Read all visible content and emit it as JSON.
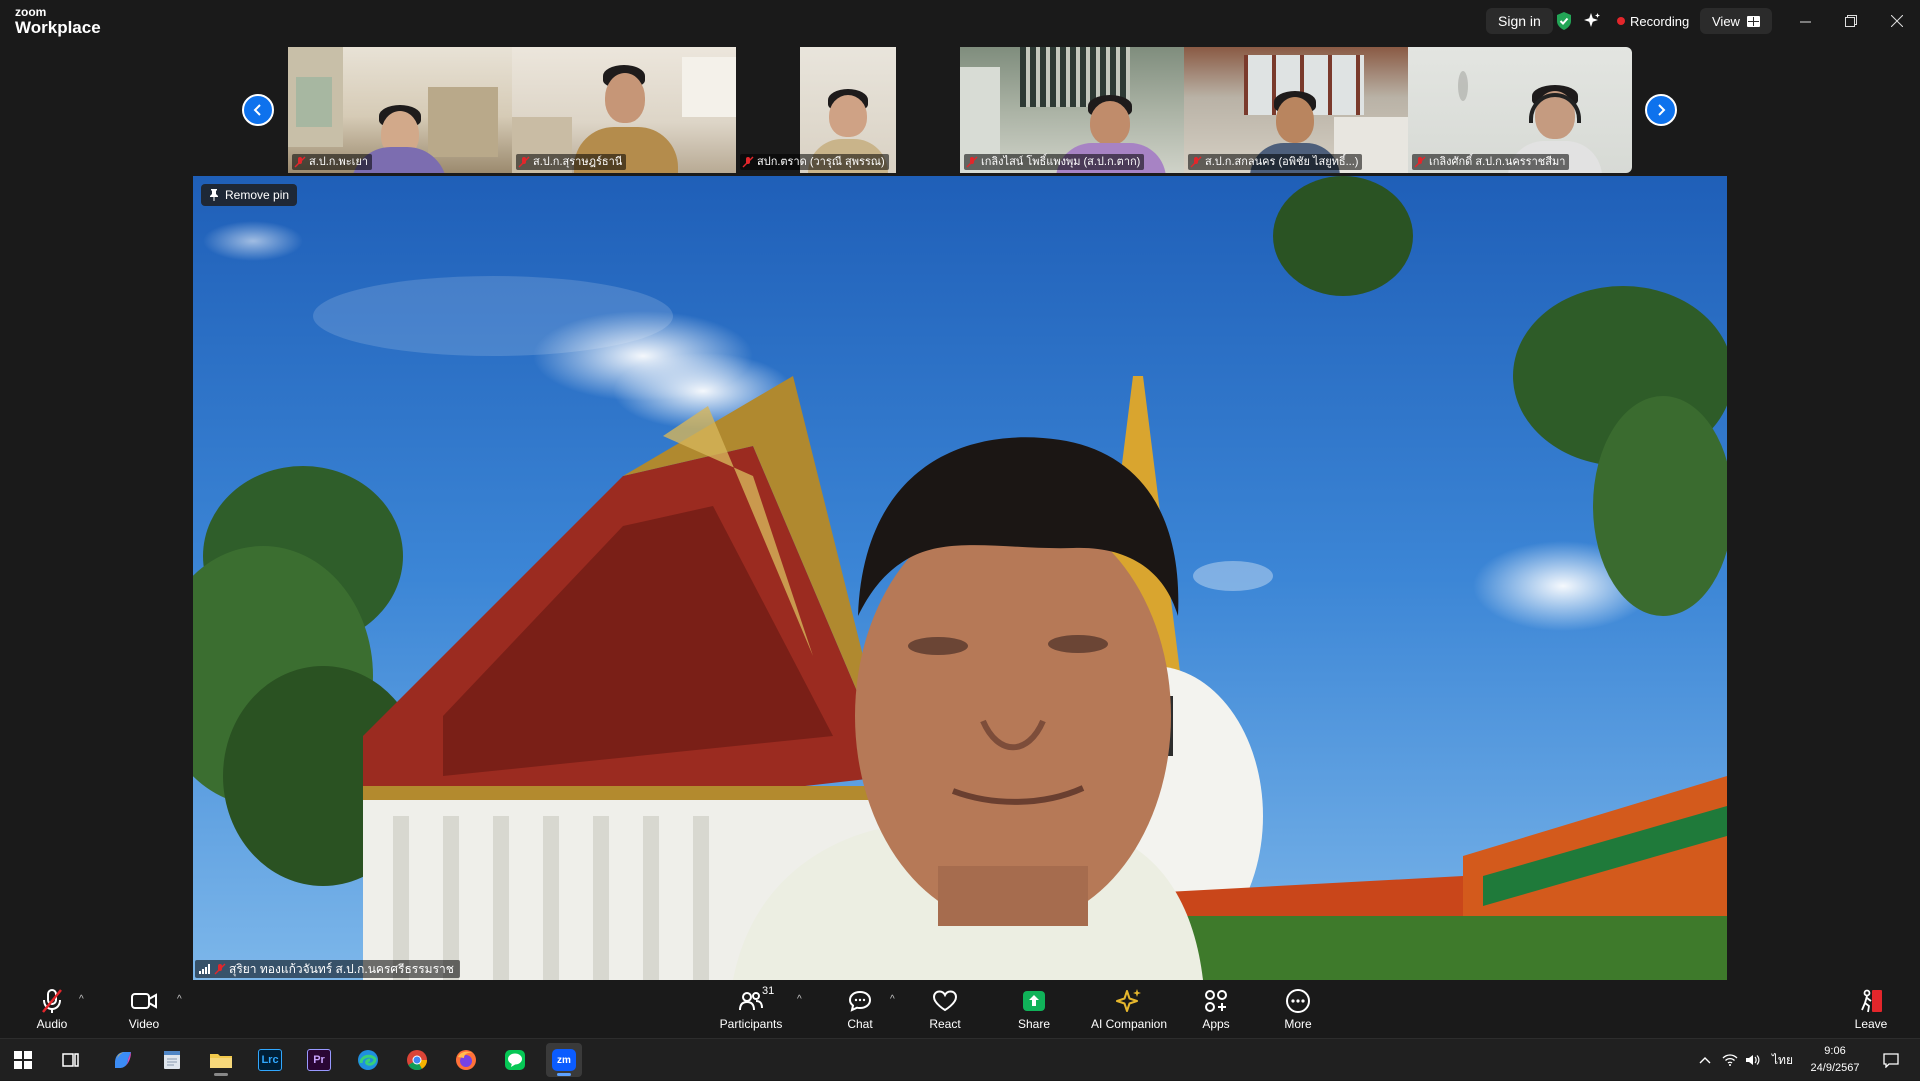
{
  "app": {
    "brand_small": "zoom",
    "brand_large": "Workplace"
  },
  "titlebar": {
    "sign_in": "Sign in",
    "recording": "Recording",
    "view": "View"
  },
  "thumbnails": [
    {
      "name": "ส.ป.ก.พะเยา"
    },
    {
      "name": "ส.ป.ก.สุราษฎร์ธานี"
    },
    {
      "name": "สปก.ตราด (วารุณี สุพรรณ)"
    },
    {
      "name": "เกลิงไสน์ โพธิ์แพงพุม (ส.ป.ก.ตาก)"
    },
    {
      "name": "ส.ป.ก.สกลนคร (อพิชัย ไสยูทธิ์...)"
    },
    {
      "name": "เกลิงศักดิ์ ส.ป.ก.นครราชสีมา"
    }
  ],
  "main_video": {
    "remove_pin": "Remove pin",
    "speaker_name": "สุริยา ทองแก้วจันทร์ ส.ป.ก.นครศรีธรรมราช"
  },
  "controls": {
    "audio": "Audio",
    "video": "Video",
    "participants": "Participants",
    "participant_count": "31",
    "chat": "Chat",
    "react": "React",
    "share": "Share",
    "ai_companion": "AI Companion",
    "apps": "Apps",
    "more": "More",
    "leave": "Leave"
  },
  "taskbar": {
    "apps": [
      "start-icon",
      "task-view-icon",
      "copilot-icon",
      "notepad-icon",
      "file-explorer-icon",
      "lightroom-classic-icon",
      "premiere-pro-icon",
      "edge-icon",
      "chrome-icon",
      "firefox-icon",
      "line-icon",
      "zoom-icon"
    ],
    "lrc_label": "Lrc",
    "pr_label": "Pr",
    "zoom_label": "zm",
    "ime": "ไทย",
    "time": "9:06",
    "date": "24/9/2567"
  },
  "colors": {
    "accent_blue": "#0e72ed",
    "recording_red": "#e3262b",
    "share_green": "#10b259",
    "ai_gold": "#e6b72d",
    "bg": "#1a1a1a"
  }
}
